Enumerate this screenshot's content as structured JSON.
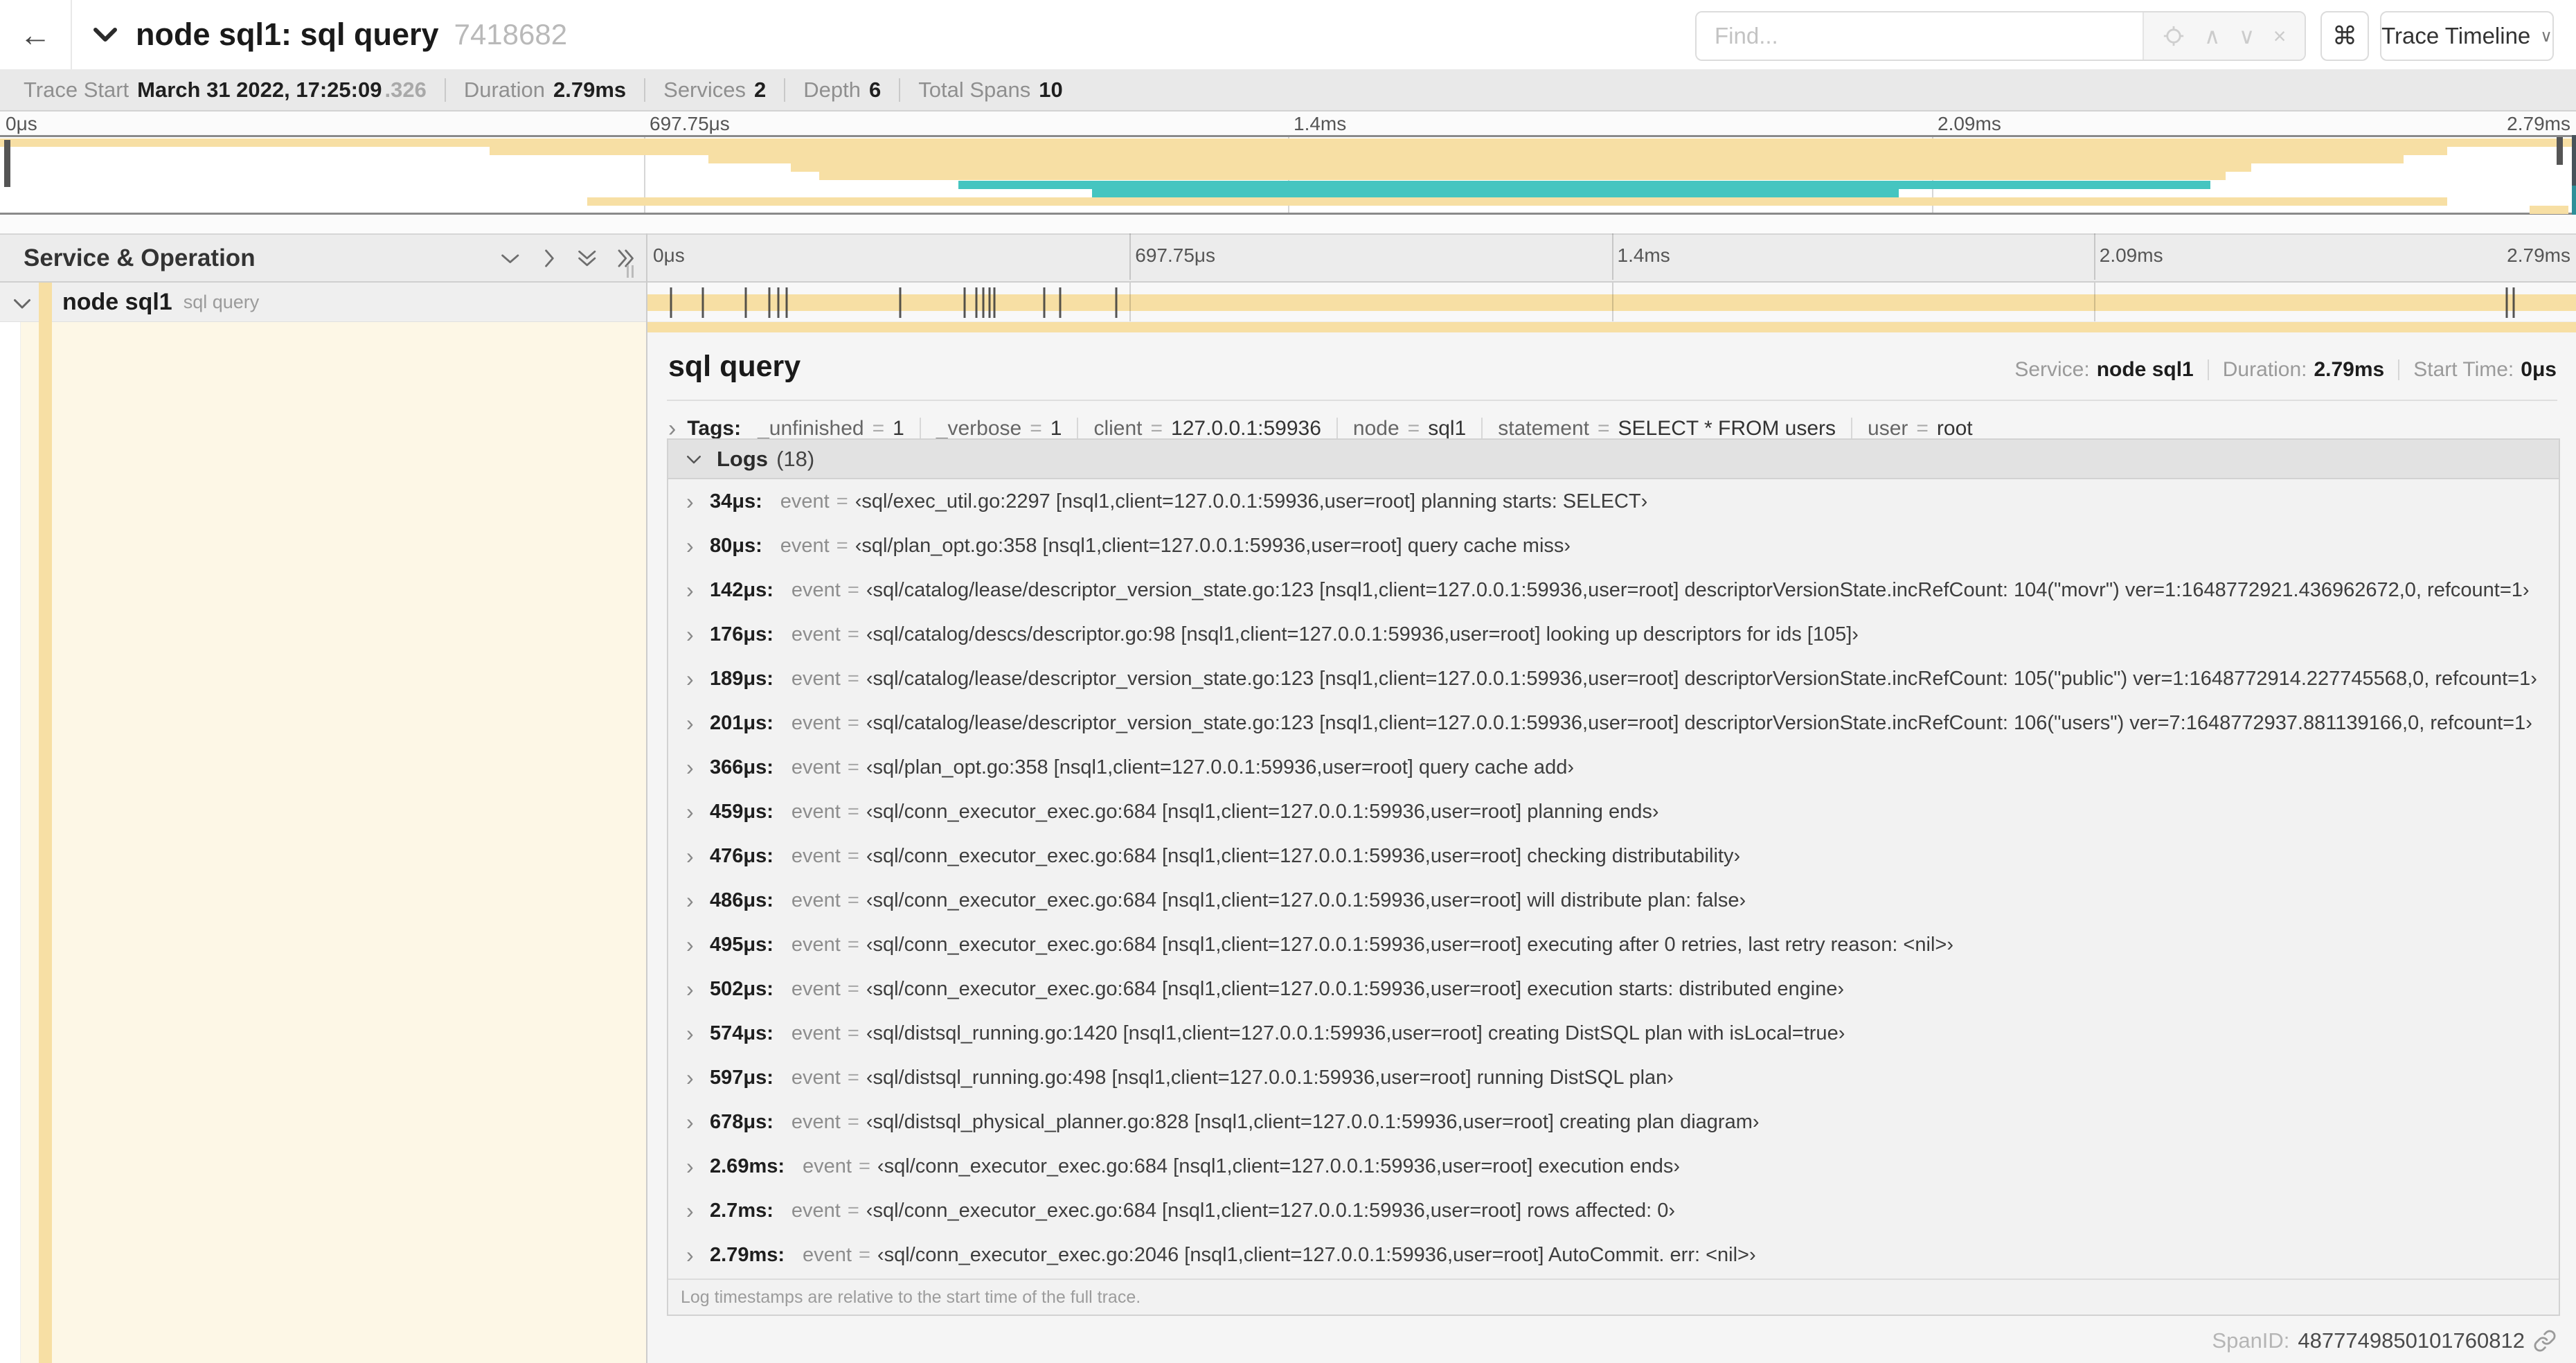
{
  "icons": {
    "back": "←",
    "command": "⌘",
    "find_prev": "∧",
    "find_next": "∨",
    "find_clear": "×",
    "dropdown": "∨",
    "chevron_right": "›"
  },
  "topbar": {
    "title": "node sql1: sql query",
    "trace_id": "7418682",
    "find_placeholder": "Find...",
    "view_button": "Trace Timeline"
  },
  "stats": {
    "items": [
      {
        "label": "Trace Start",
        "value": "March 31 2022, 17:25:09",
        "suffix": ".326"
      },
      {
        "label": "Duration",
        "value": "2.79ms"
      },
      {
        "label": "Services",
        "value": "2"
      },
      {
        "label": "Depth",
        "value": "6"
      },
      {
        "label": "Total Spans",
        "value": "10"
      }
    ]
  },
  "timeline": {
    "ticks": [
      {
        "label": "0μs",
        "pos": 0
      },
      {
        "label": "697.75μs",
        "pos": 25
      },
      {
        "label": "1.4ms",
        "pos": 50
      },
      {
        "label": "2.09ms",
        "pos": 75
      },
      {
        "label": "2.79ms",
        "pos": 100
      }
    ],
    "colors": {
      "tan": "#f7dfa4",
      "teal": "#45c5c0"
    },
    "minimap_spans": [
      {
        "row": 0,
        "start": 0.0,
        "end": 1.0,
        "color": "tan"
      },
      {
        "row": 1,
        "start": 0.19,
        "end": 0.95,
        "color": "tan"
      },
      {
        "row": 2,
        "start": 0.275,
        "end": 0.933,
        "color": "tan"
      },
      {
        "row": 3,
        "start": 0.307,
        "end": 0.874,
        "color": "tan"
      },
      {
        "row": 4,
        "start": 0.318,
        "end": 0.864,
        "color": "tan"
      },
      {
        "row": 5,
        "start": 0.372,
        "end": 0.858,
        "color": "teal"
      },
      {
        "row": 6,
        "start": 0.424,
        "end": 0.737,
        "color": "teal"
      },
      {
        "row": 7,
        "start": 0.228,
        "end": 0.95,
        "color": "tan"
      },
      {
        "row": 8,
        "start": 0.982,
        "end": 0.997,
        "color": "tan"
      }
    ]
  },
  "span_table": {
    "header": "Service & Operation",
    "service": "node sql1",
    "operation": "sql query",
    "duration_us": 2790,
    "log_marker_times_us": [
      34,
      80,
      142,
      176,
      189,
      201,
      366,
      459,
      476,
      486,
      495,
      502,
      574,
      597,
      678,
      2690,
      2700
    ]
  },
  "detail": {
    "title": "sql query",
    "meta": [
      {
        "label": "Service:",
        "value": "node sql1"
      },
      {
        "label": "Duration:",
        "value": "2.79ms"
      },
      {
        "label": "Start Time:",
        "value": "0μs"
      }
    ],
    "tags_label": "Tags:",
    "eq": "=",
    "tags": [
      {
        "key": "_unfinished",
        "value": "1"
      },
      {
        "key": "_verbose",
        "value": "1"
      },
      {
        "key": "client",
        "value": "127.0.0.1:59936"
      },
      {
        "key": "node",
        "value": "sql1"
      },
      {
        "key": "statement",
        "value": "SELECT * FROM users"
      },
      {
        "key": "user",
        "value": "root"
      }
    ],
    "logs_label": "Logs",
    "logs_count": "(18)",
    "logs": [
      {
        "t": "34μs:",
        "k": "event",
        "v": "‹sql/exec_util.go:2297 [nsql1,client=127.0.0.1:59936,user=root] planning starts: SELECT›"
      },
      {
        "t": "80μs:",
        "k": "event",
        "v": "‹sql/plan_opt.go:358 [nsql1,client=127.0.0.1:59936,user=root] query cache miss›"
      },
      {
        "t": "142μs:",
        "k": "event",
        "v": "‹sql/catalog/lease/descriptor_version_state.go:123 [nsql1,client=127.0.0.1:59936,user=root] descriptorVersionState.incRefCount: 104(\"movr\") ver=1:1648772921.436962672,0, refcount=1›"
      },
      {
        "t": "176μs:",
        "k": "event",
        "v": "‹sql/catalog/descs/descriptor.go:98 [nsql1,client=127.0.0.1:59936,user=root] looking up descriptors for ids [105]›"
      },
      {
        "t": "189μs:",
        "k": "event",
        "v": "‹sql/catalog/lease/descriptor_version_state.go:123 [nsql1,client=127.0.0.1:59936,user=root] descriptorVersionState.incRefCount: 105(\"public\") ver=1:1648772914.227745568,0, refcount=1›"
      },
      {
        "t": "201μs:",
        "k": "event",
        "v": "‹sql/catalog/lease/descriptor_version_state.go:123 [nsql1,client=127.0.0.1:59936,user=root] descriptorVersionState.incRefCount: 106(\"users\") ver=7:1648772937.881139166,0, refcount=1›"
      },
      {
        "t": "366μs:",
        "k": "event",
        "v": "‹sql/plan_opt.go:358 [nsql1,client=127.0.0.1:59936,user=root] query cache add›"
      },
      {
        "t": "459μs:",
        "k": "event",
        "v": "‹sql/conn_executor_exec.go:684 [nsql1,client=127.0.0.1:59936,user=root] planning ends›"
      },
      {
        "t": "476μs:",
        "k": "event",
        "v": "‹sql/conn_executor_exec.go:684 [nsql1,client=127.0.0.1:59936,user=root] checking distributability›"
      },
      {
        "t": "486μs:",
        "k": "event",
        "v": "‹sql/conn_executor_exec.go:684 [nsql1,client=127.0.0.1:59936,user=root] will distribute plan: false›"
      },
      {
        "t": "495μs:",
        "k": "event",
        "v": "‹sql/conn_executor_exec.go:684 [nsql1,client=127.0.0.1:59936,user=root] executing after 0 retries, last retry reason: <nil>›"
      },
      {
        "t": "502μs:",
        "k": "event",
        "v": "‹sql/conn_executor_exec.go:684 [nsql1,client=127.0.0.1:59936,user=root] execution starts: distributed engine›"
      },
      {
        "t": "574μs:",
        "k": "event",
        "v": "‹sql/distsql_running.go:1420 [nsql1,client=127.0.0.1:59936,user=root] creating DistSQL plan with isLocal=true›"
      },
      {
        "t": "597μs:",
        "k": "event",
        "v": "‹sql/distsql_running.go:498 [nsql1,client=127.0.0.1:59936,user=root] running DistSQL plan›"
      },
      {
        "t": "678μs:",
        "k": "event",
        "v": "‹sql/distsql_physical_planner.go:828 [nsql1,client=127.0.0.1:59936,user=root] creating plan diagram›"
      },
      {
        "t": "2.69ms:",
        "k": "event",
        "v": "‹sql/conn_executor_exec.go:684 [nsql1,client=127.0.0.1:59936,user=root] execution ends›"
      },
      {
        "t": "2.7ms:",
        "k": "event",
        "v": "‹sql/conn_executor_exec.go:684 [nsql1,client=127.0.0.1:59936,user=root] rows affected: 0›"
      },
      {
        "t": "2.79ms:",
        "k": "event",
        "v": "‹sql/conn_executor_exec.go:2046 [nsql1,client=127.0.0.1:59936,user=root] AutoCommit. err: <nil>›"
      }
    ],
    "footer_note": "Log timestamps are relative to the start time of the full trace.",
    "spanid_label": "SpanID:",
    "spanid": "4877749850101760812"
  }
}
